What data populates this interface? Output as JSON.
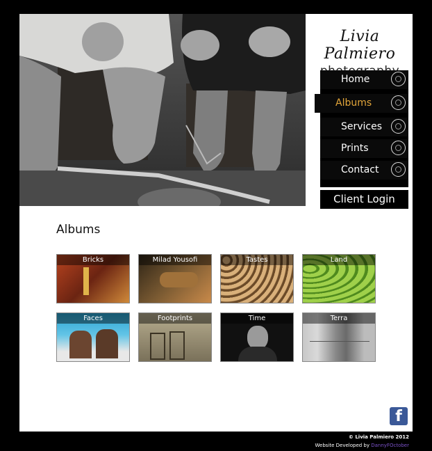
{
  "brand": {
    "name": "Livia Palmiero",
    "subtitle": "photography"
  },
  "nav": {
    "items": [
      {
        "label": "Home",
        "active": false
      },
      {
        "label": "Albums",
        "active": true
      },
      {
        "label": "Services",
        "active": false
      },
      {
        "label": "Prints",
        "active": false
      },
      {
        "label": "Contact",
        "active": false
      }
    ],
    "active_color": "#e3a63a"
  },
  "client_login": "Client Login",
  "albums": {
    "title": "Albums",
    "items": [
      {
        "caption": "Bricks"
      },
      {
        "caption": "Milad Yousofi"
      },
      {
        "caption": "Tastes"
      },
      {
        "caption": "Land"
      },
      {
        "caption": "Faces"
      },
      {
        "caption": "Footprints"
      },
      {
        "caption": "Time"
      },
      {
        "caption": "Terra"
      }
    ]
  },
  "social": {
    "facebook_icon": "facebook-icon",
    "glyph": "f"
  },
  "footer": {
    "copyright": "© Livia Palmiero 2012",
    "developed_prefix": "Website Developed by",
    "developer": "DannyFOctober"
  }
}
